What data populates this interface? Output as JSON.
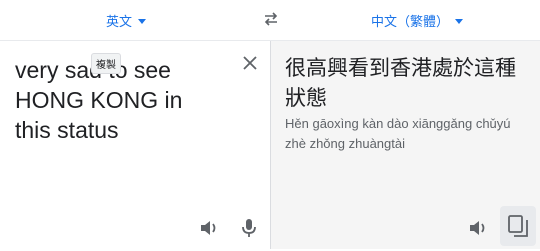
{
  "source_lang": {
    "label": "英文"
  },
  "target_lang": {
    "label": "中文（繁體）"
  },
  "source": {
    "text": "very sad to see\nHONG KONG in\nthis status",
    "tooltip": "複製"
  },
  "target": {
    "text": "很高興看到香港處於這種狀態",
    "romanization": "Hěn gāoxìng kàn dào xiānggǎng chǔyú zhè zhǒng zhuàngtài"
  },
  "icons": {
    "swap": "swap-icon",
    "close": "close-icon",
    "speaker_source": "speaker-icon",
    "mic": "microphone-icon",
    "speaker_target": "speaker-icon",
    "copy": "copy-icon"
  },
  "colors": {
    "accent": "#1a73e8",
    "icon": "#5f6368",
    "target_bg": "#f5f5f5"
  }
}
